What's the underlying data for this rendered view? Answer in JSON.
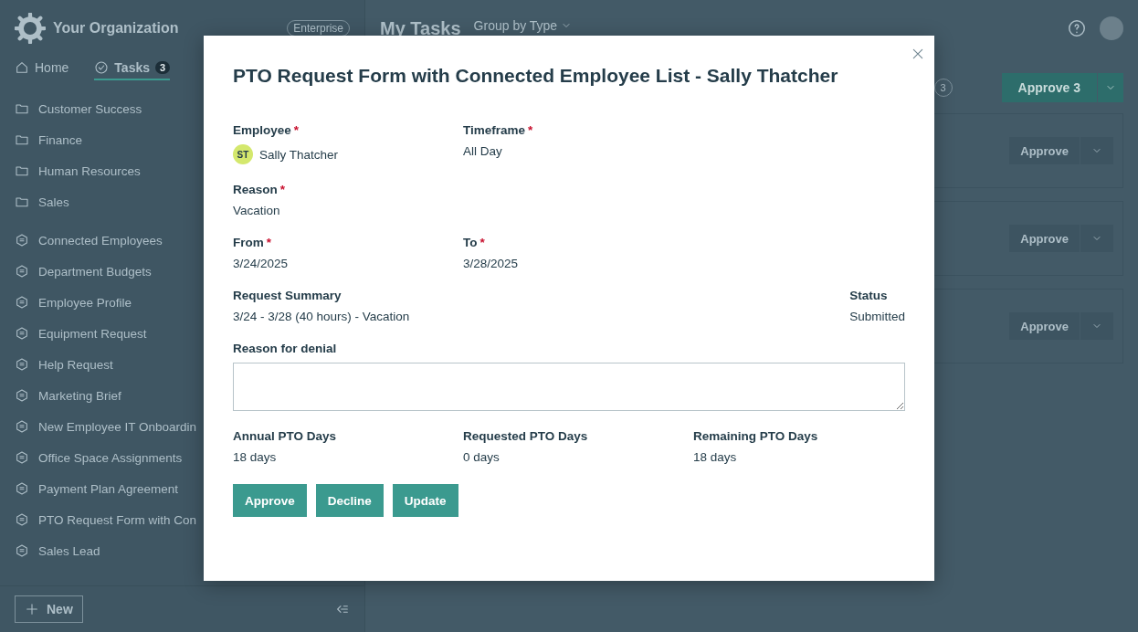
{
  "sidebar": {
    "org_name": "Your Organization",
    "plan_badge": "Enterprise",
    "nav_tabs": [
      {
        "label": "Home",
        "selected": false
      },
      {
        "label": "Tasks",
        "badge": "3",
        "selected": true
      }
    ],
    "folders": [
      "Customer Success",
      "Finance",
      "Human Resources",
      "Sales"
    ],
    "forms": [
      "Connected Employees",
      "Department Budgets",
      "Employee Profile",
      "Equipment Request",
      "Help Request",
      "Marketing Brief",
      "New Employee IT Onboardin",
      "Office Space Assignments",
      "Payment Plan Agreement",
      "PTO Request Form with Con",
      "Sales Lead"
    ],
    "new_button": "New"
  },
  "main": {
    "title": "My Tasks",
    "group_by": "Group by Type",
    "task_count": "3",
    "approve_all": {
      "label": "Approve",
      "count": "3"
    },
    "tasks": [
      {
        "action": "Approve"
      },
      {
        "action": "Approve"
      },
      {
        "action": "Approve"
      }
    ]
  },
  "modal": {
    "title": "PTO Request Form with Connected Employee List - Sally Thatcher",
    "rows": [
      {
        "kind": "grid",
        "fields": [
          {
            "kind": "person",
            "label": "Employee",
            "required_mark": "*",
            "initials": "ST",
            "value": "Sally Thatcher"
          },
          {
            "kind": "text",
            "label": "Timeframe",
            "required_mark": "*",
            "value": "All Day"
          }
        ]
      },
      {
        "kind": "grid",
        "fields": [
          {
            "kind": "text",
            "label": "Reason",
            "required_mark": "*",
            "value": "Vacation"
          }
        ]
      },
      {
        "kind": "grid",
        "fields": [
          {
            "kind": "text",
            "label": "From",
            "required_mark": "*",
            "value": "3/24/2025"
          },
          {
            "kind": "text",
            "label": "To",
            "required_mark": "*",
            "value": "3/28/2025"
          }
        ]
      },
      {
        "kind": "spread",
        "fields": [
          {
            "kind": "text",
            "label": "Request Summary",
            "value": "3/24 - 3/28 (40 hours) - Vacation"
          },
          {
            "kind": "text",
            "label": "Status",
            "value": "Submitted"
          }
        ]
      },
      {
        "kind": "full",
        "fields": [
          {
            "kind": "textarea",
            "label": "Reason for denial"
          }
        ]
      },
      {
        "kind": "grid",
        "fields": [
          {
            "kind": "text",
            "label": "Annual PTO Days",
            "value": "18 days"
          },
          {
            "kind": "text",
            "label": "Requested PTO Days",
            "value": "0 days"
          },
          {
            "kind": "text",
            "label": "Remaining PTO Days",
            "value": "18 days"
          }
        ]
      }
    ],
    "buttons": [
      "Approve",
      "Decline",
      "Update"
    ]
  }
}
